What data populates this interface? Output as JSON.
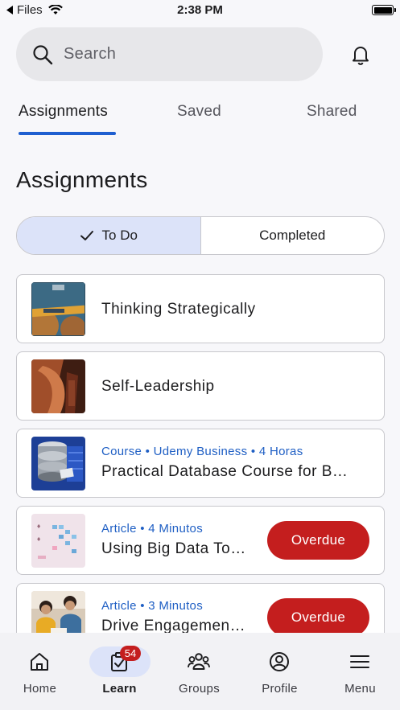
{
  "status_bar": {
    "back_app": "Files",
    "time": "2:38 PM"
  },
  "search": {
    "placeholder": "Search"
  },
  "tabs": [
    {
      "label": "Assignments",
      "active": true
    },
    {
      "label": "Saved",
      "active": false
    },
    {
      "label": "Shared",
      "active": false
    }
  ],
  "section_title": "Assignments",
  "segmented": {
    "todo": "To Do",
    "completed": "Completed"
  },
  "cards": [
    {
      "title": "Thinking Strategically",
      "thumb": "strategy-image"
    },
    {
      "title": "Self-Leadership",
      "thumb": "leadership-image"
    },
    {
      "meta": "Course • Udemy Business • 4 Horas",
      "title": "Practical Database Course for B…",
      "thumb": "database-image"
    },
    {
      "meta": "Article • 4 Minutos",
      "title": "Using Big Data To…",
      "status": "Overdue",
      "thumb": "bigdata-image"
    },
    {
      "meta": "Article • 3 Minutos",
      "title": "Drive Engagemen…",
      "status": "Overdue",
      "thumb": "engagement-image"
    }
  ],
  "nav": [
    {
      "label": "Home",
      "icon": "home-icon"
    },
    {
      "label": "Learn",
      "icon": "learn-icon",
      "active": true,
      "badge": "54"
    },
    {
      "label": "Groups",
      "icon": "groups-icon"
    },
    {
      "label": "Profile",
      "icon": "profile-icon"
    },
    {
      "label": "Menu",
      "icon": "menu-icon"
    }
  ],
  "colors": {
    "accent": "#1f5fd0",
    "overdue": "#c41e1e",
    "selected_bg": "#dce3f9"
  }
}
